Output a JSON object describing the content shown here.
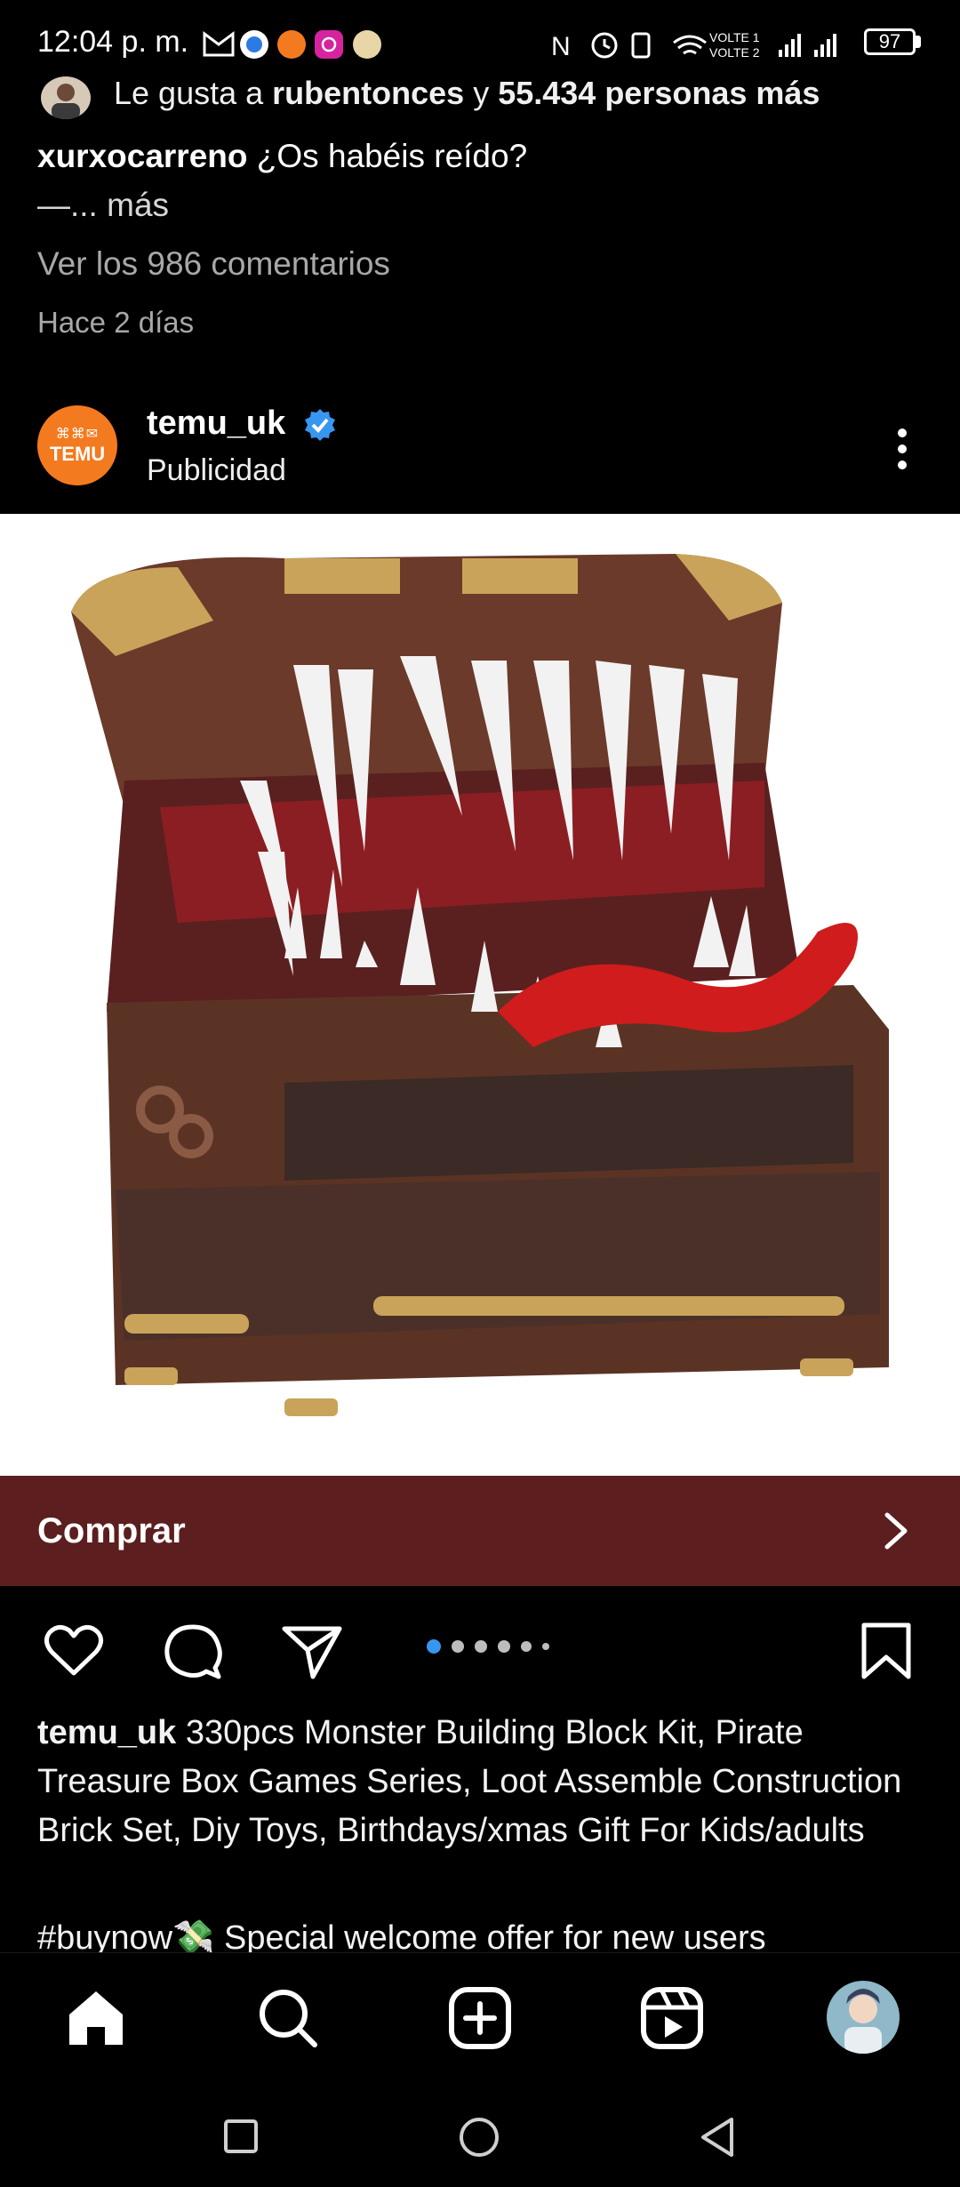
{
  "status_bar": {
    "time": "12:04 p. m.",
    "volte1": "VOLTE 1",
    "volte2": "VOLTE 2",
    "battery": "97"
  },
  "previous_post": {
    "likes_prefix": "Le gusta a ",
    "likes_user": "rubentonces",
    "likes_middle": " y ",
    "likes_count": "55.434 personas más",
    "caption_user": "xurxocarreno",
    "caption_text": " ¿Os habéis reído?",
    "caption_more": "—... más",
    "view_comments": "Ver los 986 comentarios",
    "time_ago": "Hace 2 días"
  },
  "post": {
    "avatar_text_top": "⌘⌘✉",
    "avatar_text": "TEMU",
    "username": "temu_uk",
    "sponsored": "Publicidad",
    "buy_label": "Comprar",
    "caption_user": "temu_uk",
    "caption_text": " 330pcs Monster Building Block Kit, Pirate Treasure Box Games Series, Loot Assemble Construction Brick Set, Diy Toys, Birthdays/xmas Gift For Kids/adults",
    "caption_line2": "#buynow💸 Special welcome offer for new users",
    "carousel_total": 6,
    "carousel_active": 1
  },
  "icons": {
    "like": "heart-icon",
    "comment": "comment-icon",
    "share": "send-icon",
    "save": "bookmark-icon",
    "home": "home-icon",
    "search": "search-icon",
    "create": "add-icon",
    "reels": "reels-icon",
    "profile": "avatar"
  },
  "colors": {
    "buy_bar": "#5c1e1e",
    "carousel_active": "#3797f0",
    "verified": "#3797f0",
    "temu_orange": "#f47a1f"
  }
}
